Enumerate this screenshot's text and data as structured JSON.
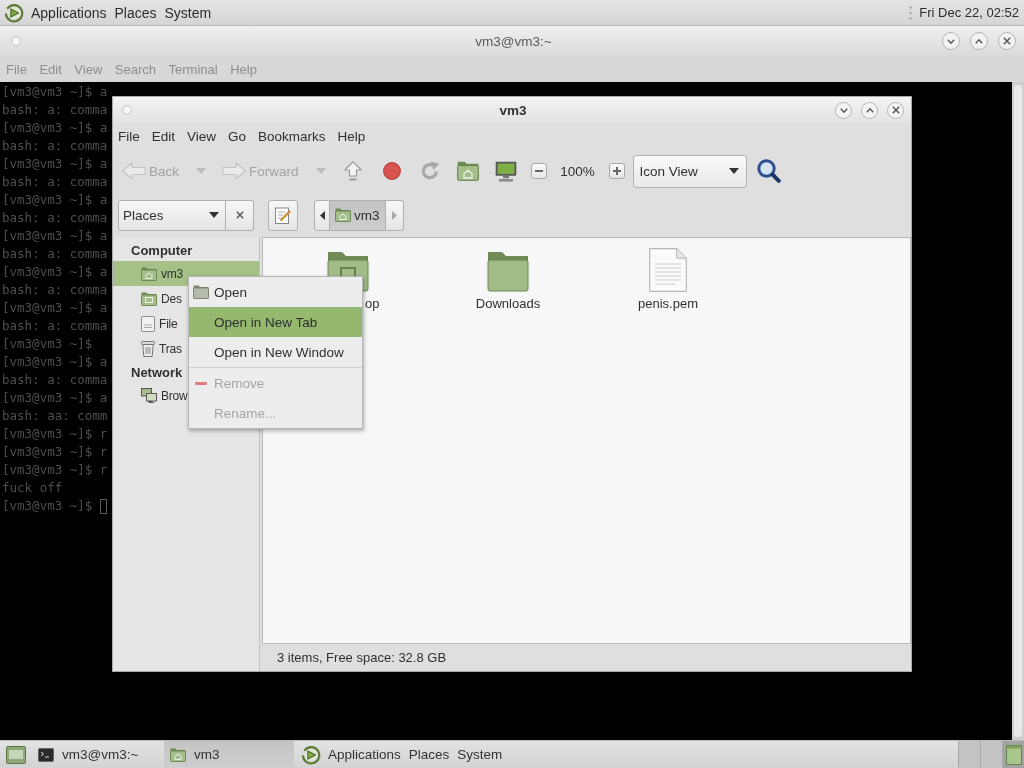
{
  "top_panel": {
    "menus": [
      "Applications",
      "Places",
      "System"
    ],
    "clock": "Fri Dec 22, 02:52"
  },
  "terminal": {
    "title": "vm3@vm3:~",
    "menus": [
      "File",
      "Edit",
      "View",
      "Search",
      "Terminal",
      "Help"
    ],
    "lines": [
      "[vm3@vm3 ~]$ a",
      "bash: a: comma",
      "[vm3@vm3 ~]$ a",
      "bash: a: comma",
      "[vm3@vm3 ~]$ a",
      "bash: a: comma",
      "[vm3@vm3 ~]$ a",
      "bash: a: comma",
      "[vm3@vm3 ~]$ a",
      "bash: a: comma",
      "[vm3@vm3 ~]$ a",
      "bash: a: comma",
      "[vm3@vm3 ~]$ a",
      "bash: a: comma",
      "[vm3@vm3 ~]$",
      "[vm3@vm3 ~]$ a",
      "bash: a: comma",
      "[vm3@vm3 ~]$ a",
      "bash: aa: comm",
      "[vm3@vm3 ~]$ r",
      "[vm3@vm3 ~]$ r",
      "[vm3@vm3 ~]$ r",
      "fuck off",
      "[vm3@vm3 ~]$"
    ],
    "cursor": true
  },
  "file_manager": {
    "title": "vm3",
    "menus": [
      "File",
      "Edit",
      "View",
      "Go",
      "Bookmarks",
      "Help"
    ],
    "toolbar": [
      {
        "kind": "back",
        "label": "Back",
        "disabled": true
      },
      {
        "kind": "history",
        "disabled": true
      },
      {
        "kind": "forward",
        "label": "Forward",
        "disabled": true
      },
      {
        "kind": "history",
        "disabled": true
      },
      {
        "kind": "up",
        "disabled": false
      },
      {
        "kind": "stop",
        "disabled": false
      },
      {
        "kind": "reload",
        "disabled": false
      },
      {
        "kind": "home",
        "disabled": false
      },
      {
        "kind": "computer",
        "disabled": false
      },
      {
        "kind": "zoom_out",
        "disabled": false
      },
      {
        "kind": "zoom_level",
        "label": "100%",
        "disabled": false
      },
      {
        "kind": "zoom_in",
        "disabled": false
      },
      {
        "kind": "view",
        "label": "Icon View",
        "disabled": false
      },
      {
        "kind": "search",
        "disabled": false
      }
    ],
    "location_bar": {
      "pane_selector": "Places",
      "scroll_back": {
        "disabled": false
      },
      "crumbs": [
        {
          "label": "vm3",
          "selected": true
        }
      ],
      "scroll_forward": {
        "disabled": true
      }
    },
    "sidebar": [
      {
        "heading": "Computer",
        "items": [
          {
            "kind": "home",
            "label": "vm3",
            "selected": true
          },
          {
            "kind": "desktop",
            "label": "Des",
            "selected": false
          },
          {
            "kind": "drive",
            "label": "File",
            "selected": false
          },
          {
            "kind": "trash",
            "label": "Tras",
            "selected": false
          }
        ]
      },
      {
        "heading": "Network",
        "items": [
          {
            "kind": "network",
            "label": "Brow",
            "selected": false
          }
        ]
      }
    ],
    "files": [
      {
        "kind": "desktop_folder",
        "name": "op"
      },
      {
        "kind": "folder",
        "name": "Downloads"
      },
      {
        "kind": "file",
        "name": "penis.pem"
      }
    ],
    "status": "3 items, Free space: 32.8 GB"
  },
  "context_menu": {
    "items": [
      {
        "kind": "open",
        "label": "Open",
        "selected": false,
        "disabled": false
      },
      {
        "kind": "plain",
        "label": "Open in New Tab",
        "selected": true,
        "disabled": false
      },
      {
        "kind": "plain",
        "label": "Open in New Window",
        "selected": false,
        "disabled": false
      },
      {
        "kind": "separator"
      },
      {
        "kind": "remove",
        "label": "Remove",
        "selected": false,
        "disabled": true
      },
      {
        "kind": "plain",
        "label": "Rename...",
        "selected": false,
        "disabled": true
      }
    ]
  },
  "taskbar": {
    "tasks": [
      {
        "kind": "terminal",
        "label": "vm3@vm3:~",
        "selected": false
      },
      {
        "kind": "files",
        "label": "vm3",
        "selected": true
      }
    ],
    "menus": [
      "Applications",
      "Places",
      "System"
    ],
    "workspaces": [
      {
        "selected": false
      },
      {
        "selected": false
      },
      {
        "selected": true
      }
    ]
  }
}
